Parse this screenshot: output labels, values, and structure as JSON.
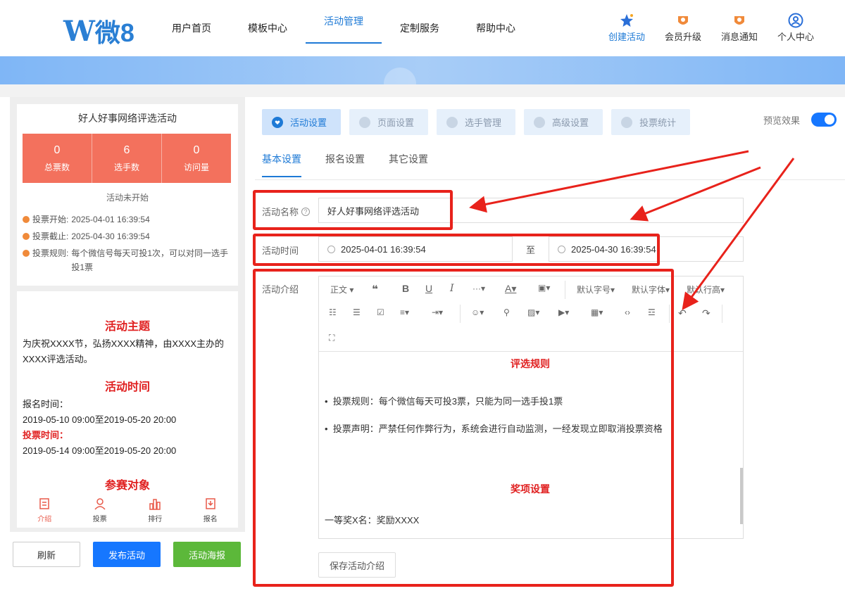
{
  "brand": {
    "logo_mark": "W",
    "logo_text": "微8"
  },
  "nav": {
    "items": [
      "用户首页",
      "模板中心",
      "活动管理",
      "定制服务",
      "帮助中心"
    ],
    "active_index": 2
  },
  "top_actions": [
    {
      "label": "创建活动",
      "icon": "star-icon"
    },
    {
      "label": "会员升级",
      "icon": "crown-icon"
    },
    {
      "label": "消息通知",
      "icon": "bell-icon"
    },
    {
      "label": "个人中心",
      "icon": "user-icon"
    }
  ],
  "preview_panel": {
    "title": "好人好事网络评选活动",
    "stats": [
      {
        "value": "0",
        "label": "总票数"
      },
      {
        "value": "6",
        "label": "选手数"
      },
      {
        "value": "0",
        "label": "访问量"
      }
    ],
    "status": "活动未开始",
    "info": [
      {
        "key": "投票开始:",
        "value": "2025-04-01 16:39:54"
      },
      {
        "key": "投票截止:",
        "value": "2025-04-30 16:39:54"
      },
      {
        "key": "投票规则:",
        "value": "每个微信号每天可投1次，可以对同一选手投1票"
      }
    ],
    "intro": {
      "theme_heading": "活动主题",
      "theme_text": "为庆祝XXXX节，弘扬XXXX精神，由XXXX主办的XXXX评选活动。",
      "time_heading": "活动时间",
      "signup_label": "报名时间：",
      "signup_range": "2019-05-10 09:00至2019-05-20 20:00",
      "vote_label": "投票时间：",
      "vote_range": "2019-05-14 09:00至2019-05-20 20:00",
      "target_heading": "参赛对象"
    },
    "tabs": [
      "介绍",
      "投票",
      "排行",
      "报名"
    ]
  },
  "left_buttons": {
    "refresh": "刷新",
    "publish": "发布活动",
    "poster": "活动海报"
  },
  "settings_tabs": [
    "活动设置",
    "页面设置",
    "选手管理",
    "高级设置",
    "投票统计"
  ],
  "preview_toggle": {
    "label": "预览效果",
    "on": true
  },
  "sub_tabs": [
    "基本设置",
    "报名设置",
    "其它设置"
  ],
  "form": {
    "name_label": "活动名称",
    "name_value": "好人好事网络评选活动",
    "time_label": "活动时间",
    "time_start": "2025-04-01 16:39:54",
    "time_sep": "至",
    "time_end": "2025-04-30 16:39:54",
    "intro_label": "活动介绍"
  },
  "editor_toolbar": {
    "paragraph": "正文",
    "font_size": "默认字号",
    "font_family": "默认字体",
    "line_height": "默认行高"
  },
  "editor_content": {
    "rules_heading": "评选规则",
    "rule1": "投票规则：每个微信每天可投3票，只能为同一选手投1票",
    "rule2": "投票声明：严禁任何作弊行为，系统会进行自动监测，一经发现立即取消投票资格",
    "prize_heading": "奖项设置",
    "prize1": "一等奖X名：奖励XXXX"
  },
  "save_button": "保存活动介绍",
  "colors": {
    "accent": "#1e7ad6",
    "stat_bg": "#f3715d",
    "annotation": "#e8221b",
    "publish": "#1677ff",
    "poster": "#5cb83a"
  }
}
